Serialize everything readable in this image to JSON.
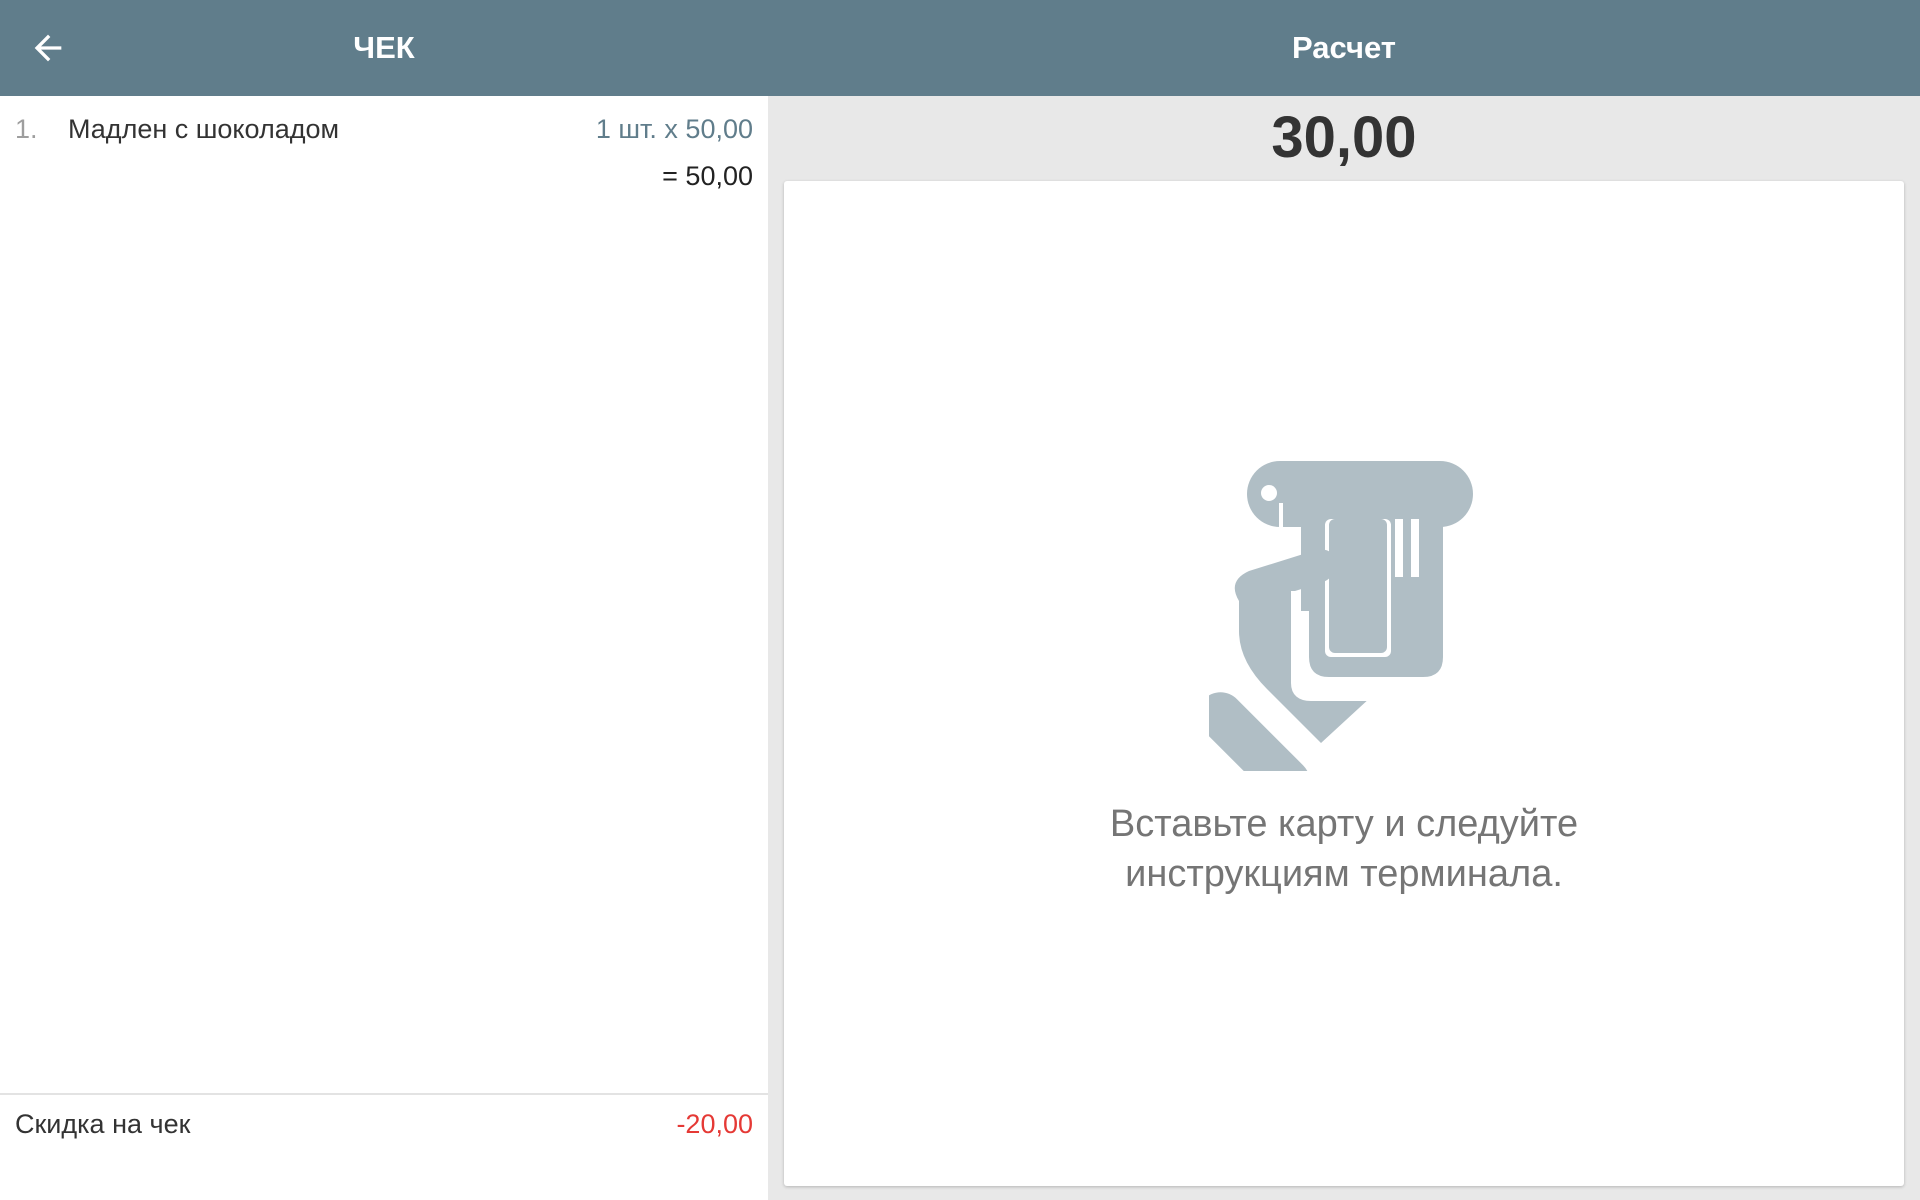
{
  "colors": {
    "header_bg": "#607d8b",
    "icon_gray": "#b0bec5",
    "discount_red": "#e53935",
    "qty_blue_gray": "#607d8b"
  },
  "header": {
    "back_icon": "arrow-left-icon",
    "left_title": "ЧЕК",
    "right_title": "Расчет"
  },
  "receipt": {
    "items": [
      {
        "index": "1.",
        "name": "Мадлен с шоколадом",
        "quantity_price": "1 шт. x 50,00",
        "total": "= 50,00"
      }
    ],
    "discount": {
      "label": "Скидка на чек",
      "value": "-20,00"
    }
  },
  "payment": {
    "amount": "30,00",
    "terminal_icon": "card-terminal-hand-icon",
    "message": "Вставьте карту и следуйте\nинструкциям терминала."
  }
}
